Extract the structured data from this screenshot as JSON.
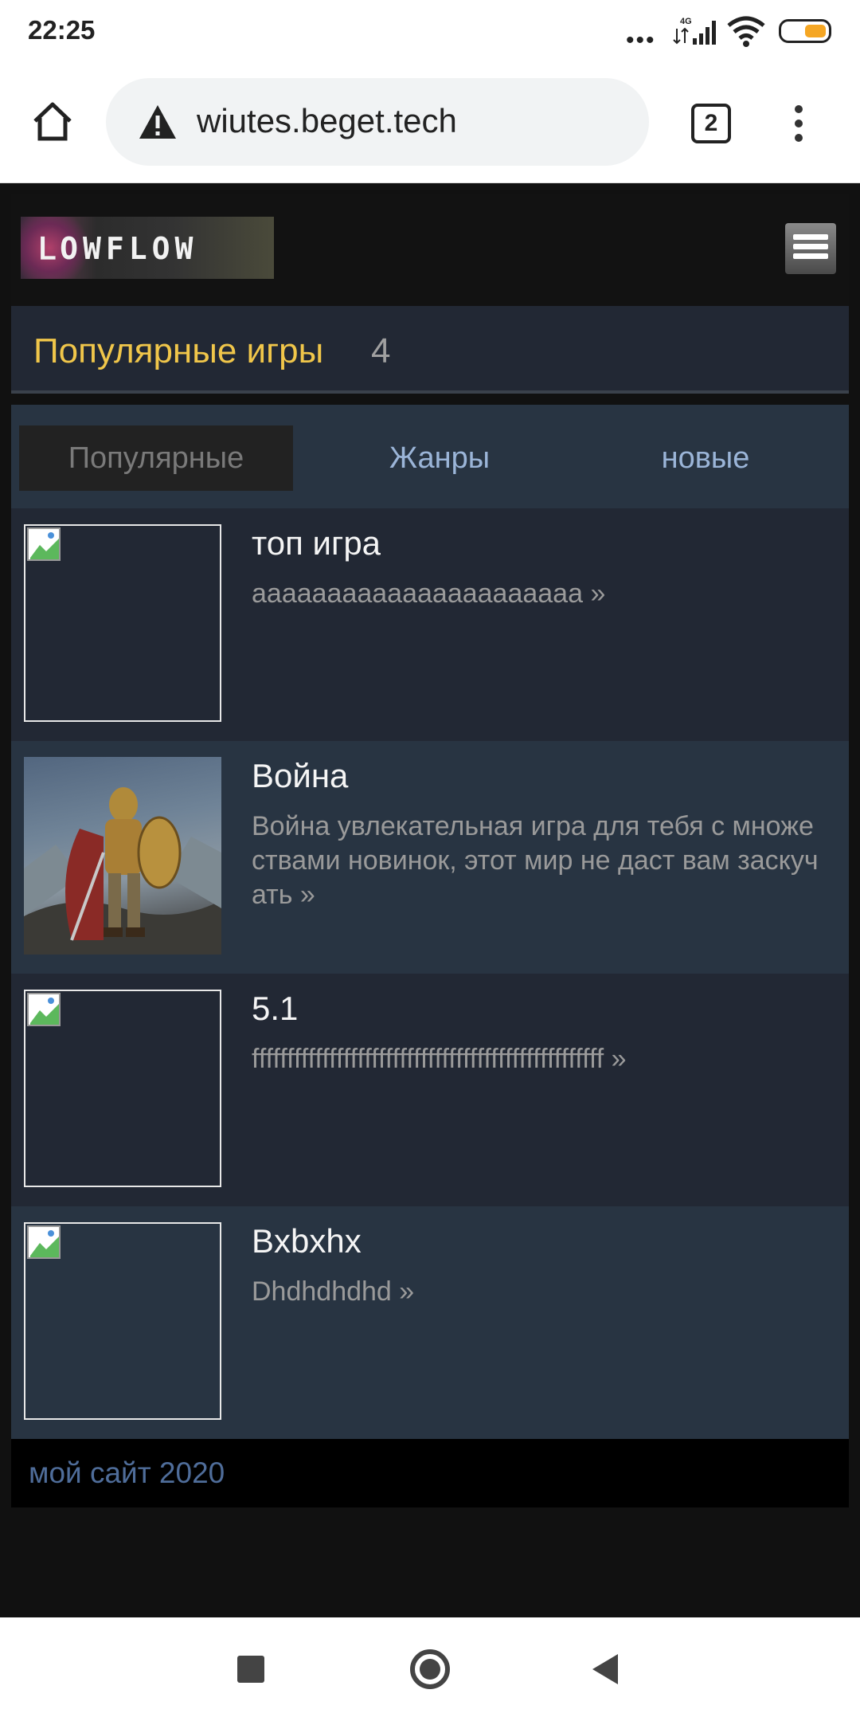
{
  "status_bar": {
    "time": "22:25",
    "network": "4G",
    "icons": [
      "more-dots-icon",
      "signal-icon",
      "wifi-icon",
      "battery-icon"
    ],
    "battery_color": "#f5a623"
  },
  "browser": {
    "url": "wiutes.beget.tech",
    "tab_count": "2",
    "icons": [
      "home-icon",
      "warning-icon",
      "tabs-icon",
      "overflow-menu-icon"
    ]
  },
  "site": {
    "logo_text": "ᒪOWFLOW",
    "section_title": "Популярные игры",
    "section_count": "4",
    "tabs": [
      {
        "label": "Популярные",
        "active": true
      },
      {
        "label": "Жанры",
        "active": false
      },
      {
        "label": "новые",
        "active": false
      }
    ],
    "games": [
      {
        "name": "топ игра",
        "desc": "аааааааааааааааааааааа »",
        "image": "broken-image-icon"
      },
      {
        "name": "Война",
        "desc": "Война увлекательная игра для тебя с множествами новинок, этот мир не даст вам заскучать »",
        "image": "knight-artwork"
      },
      {
        "name": "5.1",
        "desc": "ffffffffffffffffffffffffffffffffffffffffffffffffff »",
        "image": "broken-image-icon"
      },
      {
        "name": "Bxbxhx",
        "desc": "Dhdhdhdhd »",
        "image": "broken-image-icon"
      }
    ],
    "footer": "мой сайт 2020",
    "colors": {
      "title": "#f0c64a",
      "tab_link": "#9bb5d8",
      "footer_text": "#4f6d9a",
      "row_dark": "#222834",
      "row_light": "#283442"
    }
  },
  "nav_bar": {
    "icons": [
      "recents-square-icon",
      "home-circle-icon",
      "back-triangle-icon"
    ]
  }
}
